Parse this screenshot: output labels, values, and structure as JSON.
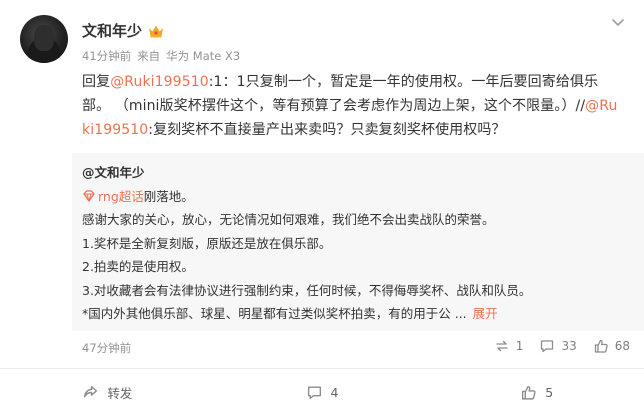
{
  "post": {
    "username": "文和年少",
    "time": "41分钟前",
    "source_prefix": "来自",
    "source_device": "华为 Mate X3",
    "reply": {
      "prefix": "回复",
      "mention_1": "@Ruki199510",
      "text_1": ":1：1只复制一个，暂定是一年的使用权。一年后要回寄给俱乐部。  （mini版奖杯摆件这个，等有预算了会考虑作为周边上架，这个不限量。）//",
      "mention_2": "@Ruki199510",
      "text_2": ":复刻奖杯不直接量产出来卖吗？只卖复刻奖杯使用权吗？"
    },
    "quote": {
      "author": "@文和年少",
      "topic": "rng超话",
      "topic_suffix": "刚落地。",
      "lines": [
        "感谢大家的关心，放心，无论情况如何艰难，我们绝不会出卖战队的荣誉。",
        "1.奖杯是全新复刻版，原版还是放在俱乐部。",
        "2.拍卖的是使用权。",
        "3.对收藏者会有法律协议进行强制约束，任何时候，不得侮辱奖杯、战队和队员。",
        "*国内外其他俱乐部、球星、明星都有过类似奖杯拍卖，有的用于公 ..."
      ],
      "expand_label": "展开",
      "time": "47分钟前",
      "reply_count": "1",
      "comment_count": "33",
      "like_count": "68"
    },
    "actions": {
      "repost_label": "转发",
      "comment_count": "4",
      "like_count": "5"
    }
  },
  "icons": {
    "crown": "crown-icon",
    "chevron": "chevron-down-icon",
    "topic": "diamond-topic-icon",
    "repost": "repost-icon",
    "comment": "comment-icon",
    "like": "thumbs-up-icon"
  },
  "colors": {
    "accent": "#eb7350",
    "meta": "#939393",
    "quote_bg": "#f7f7f7"
  }
}
